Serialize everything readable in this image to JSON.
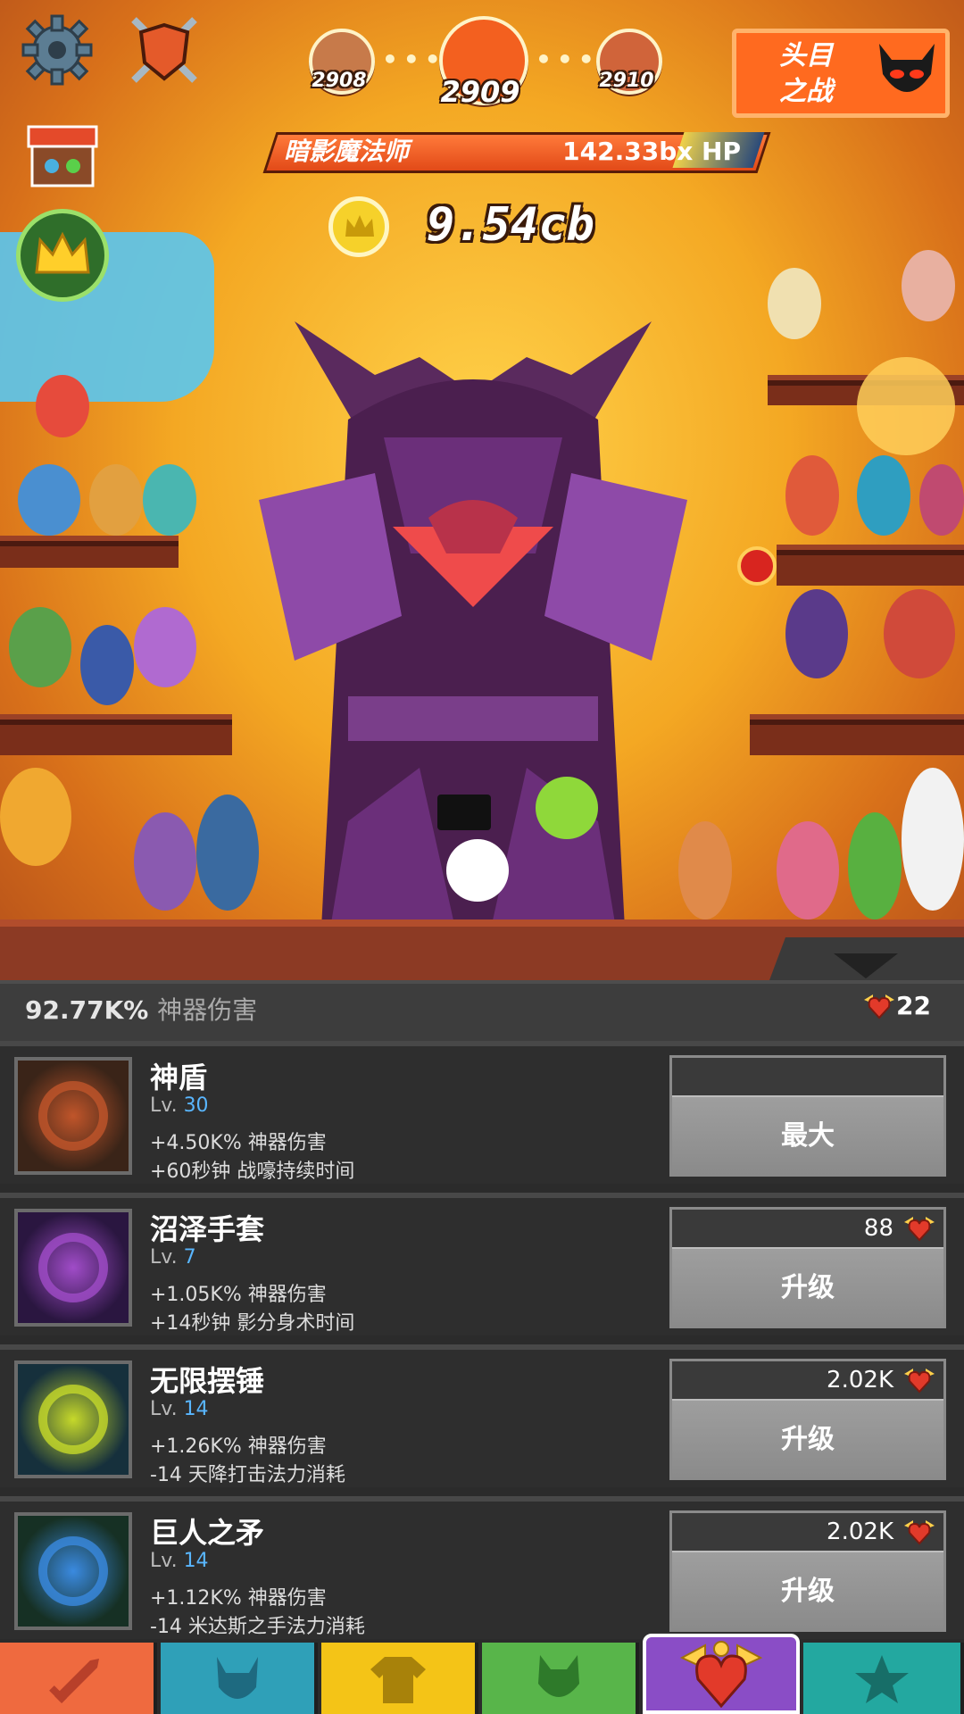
{
  "hud": {
    "stages": {
      "prev": "2908",
      "current": "2909",
      "next": "2910"
    },
    "boss_fight_label": "头目\n之战",
    "boss": {
      "name": "暗影魔法师",
      "hp": "142.33bx HP"
    },
    "gold": "9.54cb"
  },
  "icons": {
    "settings": "gear-icon",
    "clan": "shield-swords-icon",
    "shop": "shop-stall-icon",
    "vip": "crown-icon",
    "boss_fight": "demon-face-icon",
    "gold": "crown-coin-icon",
    "relic": "winged-heart-icon"
  },
  "panel": {
    "total_damage_value": "92.77K%",
    "total_damage_label": "神器伤害",
    "relics": "22"
  },
  "artifacts": [
    {
      "name": "神盾",
      "lv_label": "Lv.",
      "level": "30",
      "effect1": "+4.50K% 神器伤害",
      "effect2": "+60秒钟 战嚎持续时间",
      "cost": "",
      "button": "最大",
      "thumb_color": "#3a2418",
      "thumb_accent": "#c0552a"
    },
    {
      "name": "沼泽手套",
      "lv_label": "Lv.",
      "level": "7",
      "effect1": "+1.05K% 神器伤害",
      "effect2": "+14秒钟 影分身术时间",
      "cost": "88",
      "button": "升级",
      "thumb_color": "#2a1640",
      "thumb_accent": "#a04cc8"
    },
    {
      "name": "无限摆锤",
      "lv_label": "Lv.",
      "level": "14",
      "effect1": "+1.26K% 神器伤害",
      "effect2": "-14 天降打击法力消耗",
      "cost": "2.02K",
      "button": "升级",
      "thumb_color": "#16303c",
      "thumb_accent": "#c6d92a"
    },
    {
      "name": "巨人之矛",
      "lv_label": "Lv.",
      "level": "14",
      "effect1": "+1.12K% 神器伤害",
      "effect2": "-14 米达斯之手法力消耗",
      "cost": "2.02K",
      "button": "升级",
      "thumb_color": "#163024",
      "thumb_accent": "#3a8ae0"
    }
  ],
  "nav": [
    {
      "id": "sword-master",
      "icon": "sword-icon",
      "color": "#ef6a3f"
    },
    {
      "id": "heroes",
      "icon": "viking-helmet-icon",
      "color": "#2fa0b8"
    },
    {
      "id": "equipment",
      "icon": "tunic-icon",
      "color": "#f4c417"
    },
    {
      "id": "pets",
      "icon": "pet-head-icon",
      "color": "#58b54a"
    },
    {
      "id": "artifacts",
      "icon": "winged-heart-icon",
      "color": "#8a4dc6",
      "active": true
    },
    {
      "id": "shop",
      "icon": "star-icon",
      "color": "#23a8a0"
    }
  ]
}
